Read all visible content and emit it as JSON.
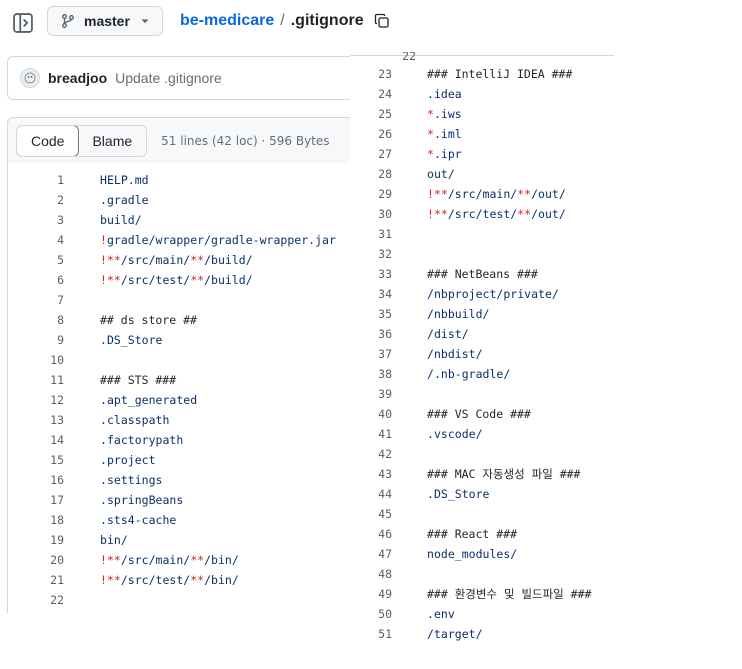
{
  "header": {
    "branch": "master",
    "repo": "be-medicare",
    "separator": "/",
    "file": ".gitignore"
  },
  "commit": {
    "author": "breadjoo",
    "message": "Update .gitignore"
  },
  "file_header": {
    "tab_code": "Code",
    "tab_blame": "Blame",
    "meta": "51 lines (42 loc) · 596 Bytes"
  },
  "icons": {
    "sidebar": "sidebar-toggle-icon",
    "branch": "git-branch-icon",
    "caret": "triangle-down-icon",
    "copy": "copy-icon"
  },
  "colors": {
    "link": "#0969da",
    "string": "#0a3069",
    "keyword": "#cf222e",
    "line_number": "#57606a"
  },
  "lines_left": [
    {
      "n": "1",
      "t": "HELP.md"
    },
    {
      "n": "2",
      "t": ".gradle"
    },
    {
      "n": "3",
      "t": "build/"
    },
    {
      "n": "4",
      "t": "!gradle/wrapper/gradle-wrapper.jar"
    },
    {
      "n": "5",
      "t": "!**/src/main/**/build/"
    },
    {
      "n": "6",
      "t": "!**/src/test/**/build/"
    },
    {
      "n": "7",
      "t": ""
    },
    {
      "n": "8",
      "t": "## ds store ##"
    },
    {
      "n": "9",
      "t": ".DS_Store"
    },
    {
      "n": "10",
      "t": ""
    },
    {
      "n": "11",
      "t": "### STS ###"
    },
    {
      "n": "12",
      "t": ".apt_generated"
    },
    {
      "n": "13",
      "t": ".classpath"
    },
    {
      "n": "14",
      "t": ".factorypath"
    },
    {
      "n": "15",
      "t": ".project"
    },
    {
      "n": "16",
      "t": ".settings"
    },
    {
      "n": "17",
      "t": ".springBeans"
    },
    {
      "n": "18",
      "t": ".sts4-cache"
    },
    {
      "n": "19",
      "t": "bin/"
    },
    {
      "n": "20",
      "t": "!**/src/main/**/bin/"
    },
    {
      "n": "21",
      "t": "!**/src/test/**/bin/"
    },
    {
      "n": "22",
      "t": ""
    }
  ],
  "lines_right": [
    {
      "n": "23",
      "t": "### IntelliJ IDEA ###"
    },
    {
      "n": "24",
      "t": ".idea"
    },
    {
      "n": "25",
      "t": "*.iws"
    },
    {
      "n": "26",
      "t": "*.iml"
    },
    {
      "n": "27",
      "t": "*.ipr"
    },
    {
      "n": "28",
      "t": "out/"
    },
    {
      "n": "29",
      "t": "!**/src/main/**/out/"
    },
    {
      "n": "30",
      "t": "!**/src/test/**/out/"
    },
    {
      "n": "31",
      "t": ""
    },
    {
      "n": "32",
      "t": ""
    },
    {
      "n": "33",
      "t": "### NetBeans ###"
    },
    {
      "n": "34",
      "t": "/nbproject/private/"
    },
    {
      "n": "35",
      "t": "/nbbuild/"
    },
    {
      "n": "36",
      "t": "/dist/"
    },
    {
      "n": "37",
      "t": "/nbdist/"
    },
    {
      "n": "38",
      "t": "/.nb-gradle/"
    },
    {
      "n": "39",
      "t": ""
    },
    {
      "n": "40",
      "t": "### VS Code ###"
    },
    {
      "n": "41",
      "t": ".vscode/"
    },
    {
      "n": "42",
      "t": ""
    },
    {
      "n": "43",
      "t": "### MAC 자동생성 파일 ###"
    },
    {
      "n": "44",
      "t": ".DS_Store"
    },
    {
      "n": "45",
      "t": ""
    },
    {
      "n": "46",
      "t": "### React ###"
    },
    {
      "n": "47",
      "t": "node_modules/"
    },
    {
      "n": "48",
      "t": ""
    },
    {
      "n": "49",
      "t": "### 환경변수 및 빌드파일 ###"
    },
    {
      "n": "50",
      "t": ".env"
    },
    {
      "n": "51",
      "t": "/target/"
    }
  ]
}
